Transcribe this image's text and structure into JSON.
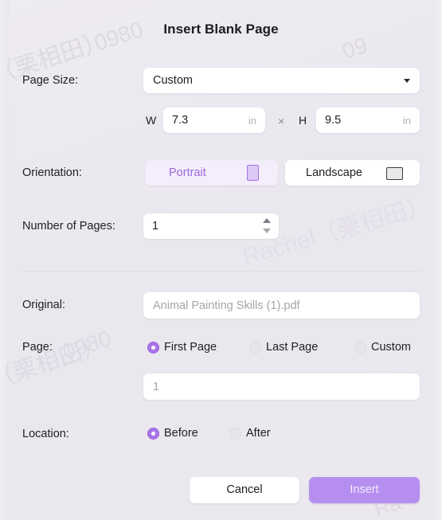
{
  "dialog": {
    "title": "Insert Blank Page"
  },
  "watermarks": {
    "a": "（栗相田）",
    "b": "0980",
    "c": "Rachel（栗相田）",
    "d": "（栗相田）",
    "e": "0980",
    "f": "09",
    "g": "Ra"
  },
  "page_size": {
    "label": "Page Size:",
    "selected": "Custom",
    "options": [
      "Custom"
    ],
    "caret_icon": "chevron-down-icon"
  },
  "dimensions": {
    "width_prefix": "W",
    "width_value": "7.3",
    "width_unit": "in",
    "separator": "×",
    "height_prefix": "H",
    "height_value": "9.5",
    "height_unit": "in"
  },
  "orientation": {
    "label": "Orientation:",
    "portrait_label": "Portrait",
    "landscape_label": "Landscape",
    "selected": "Portrait",
    "portrait_icon": "portrait-rectangle-icon",
    "landscape_icon": "landscape-rectangle-icon"
  },
  "number_of_pages": {
    "label": "Number of Pages:",
    "value": "1",
    "stepper_up_icon": "triangle-up-icon",
    "stepper_down_icon": "triangle-down-icon"
  },
  "original": {
    "label": "Original:",
    "value": "Animal Painting Skills (1).pdf"
  },
  "page": {
    "label": "Page:",
    "options": [
      "First Page",
      "Last Page",
      "Custom"
    ],
    "selected": "First Page",
    "custom_value": "1"
  },
  "location": {
    "label": "Location:",
    "options": [
      "Before",
      "After"
    ],
    "selected": "Before"
  },
  "footer": {
    "cancel_label": "Cancel",
    "insert_label": "Insert"
  },
  "colors": {
    "accent": "#a974e8",
    "accent_button": "#b68ef0",
    "accent_soft_bg": "#f4eefc",
    "accent_text": "#9a68dd",
    "background": "#ece9ef",
    "field_bg": "#ffffff",
    "text": "#1f1f22",
    "muted_text": "#a6a3ab"
  }
}
